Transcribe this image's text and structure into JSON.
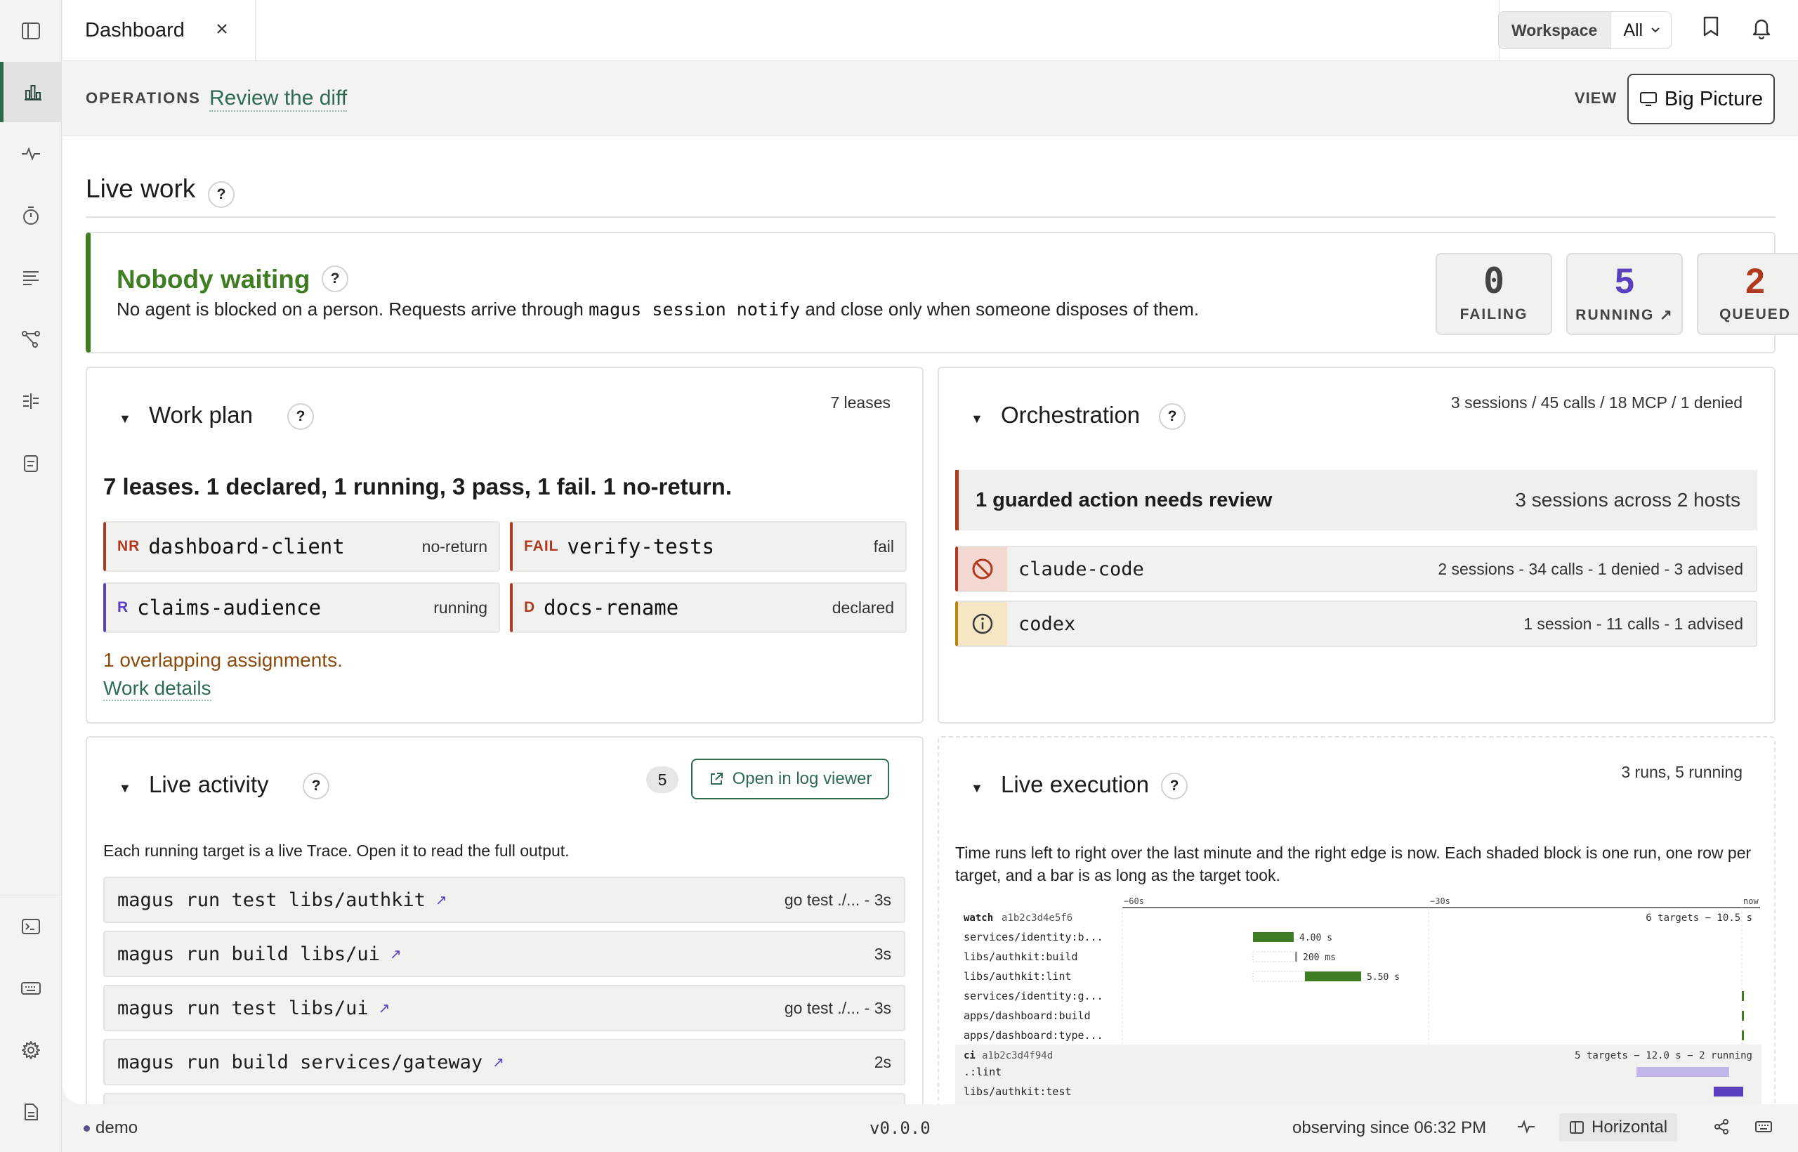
{
  "tab": {
    "title": "Dashboard"
  },
  "workspace": {
    "label": "Workspace",
    "value": "All"
  },
  "ops": {
    "section_label": "OPERATIONS",
    "link": "Review the diff",
    "view_label": "VIEW",
    "view_button": "Big Picture"
  },
  "live_work": {
    "title": "Live work",
    "help": "?"
  },
  "banner": {
    "title": "Nobody waiting",
    "desc_before": "No agent is blocked on a person. Requests arrive through",
    "desc_code": "magus session notify",
    "desc_after": "and close only when someone disposes of them.",
    "stats": [
      {
        "value": "0",
        "label": "FAILING",
        "color": "#444444"
      },
      {
        "value": "5",
        "label": "RUNNING ↗",
        "color": "#5a3fbf"
      },
      {
        "value": "2",
        "label": "QUEUED",
        "color": "#b03a1f"
      }
    ]
  },
  "work_plan": {
    "title": "Work plan",
    "meta": "7 leases",
    "summary": "7 leases. 1 declared, 1 running, 3 pass, 1 fail. 1 no-return.",
    "leases": [
      {
        "tag": "NR",
        "name": "dashboard-client",
        "status": "no-return",
        "color": "#b03a1f"
      },
      {
        "tag": "FAIL",
        "name": "verify-tests",
        "status": "fail",
        "color": "#b03a1f"
      },
      {
        "tag": "R",
        "name": "claims-audience",
        "status": "running",
        "color": "#5a3fbf"
      },
      {
        "tag": "D",
        "name": "docs-rename",
        "status": "declared",
        "color": "#b03a1f"
      }
    ],
    "overlap": "1 overlapping assignments.",
    "details_link": "Work details"
  },
  "orchestration": {
    "title": "Orchestration",
    "meta": "3 sessions / 45 calls / 18 MCP / 1 denied",
    "guard_title": "1 guarded action needs review",
    "guard_meta": "3 sessions across 2 hosts",
    "agents": [
      {
        "name": "claude-code",
        "meta": "2 sessions - 34 calls - 1 denied - 3 advised",
        "icon": "denied-icon",
        "color": "#b03a1f"
      },
      {
        "name": "codex",
        "meta": "1 session - 11 calls - 1 advised",
        "icon": "info-icon",
        "color": "#b8860b"
      }
    ]
  },
  "live_activity": {
    "title": "Live activity",
    "count": "5",
    "open_button": "Open in log viewer",
    "desc": "Each running target is a live Trace. Open it to read the full output.",
    "traces": [
      {
        "cmd": "magus run test libs/authkit",
        "meta": "go test ./... - 3s"
      },
      {
        "cmd": "magus run build libs/ui",
        "meta": "3s"
      },
      {
        "cmd": "magus run test libs/ui",
        "meta": "go test ./... - 3s"
      },
      {
        "cmd": "magus run build services/gateway",
        "meta": "2s"
      }
    ]
  },
  "live_execution": {
    "title": "Live execution",
    "meta": "3 runs, 5 running",
    "desc": "Time runs left to right over the last minute and the right edge is now. Each shaded block is one run, one row per target, and a bar is as long as the target took.",
    "axis": [
      "−60s",
      "−30s",
      "now"
    ],
    "groups": [
      {
        "label": "watch",
        "id": "a1b2c3d4e5f6",
        "summary": "6 targets − 10.5 s",
        "rows": [
          "services/identity:b...",
          "libs/authkit:build",
          "libs/authkit:lint",
          "services/identity:g...",
          "apps/dashboard:build",
          "apps/dashboard:type..."
        ],
        "durations": [
          "4.00 s",
          "200 ms",
          "5.50 s"
        ]
      },
      {
        "label": "ci",
        "id": "a1b2c3d4f94d",
        "summary": "5 targets − 12.0 s − 2 running",
        "rows": [
          ".:lint",
          "libs/authkit:test"
        ]
      }
    ]
  },
  "footer": {
    "env": "demo",
    "version": "v0.0.0",
    "observing": "observing since 06:32 PM",
    "layout": "Horizontal"
  }
}
